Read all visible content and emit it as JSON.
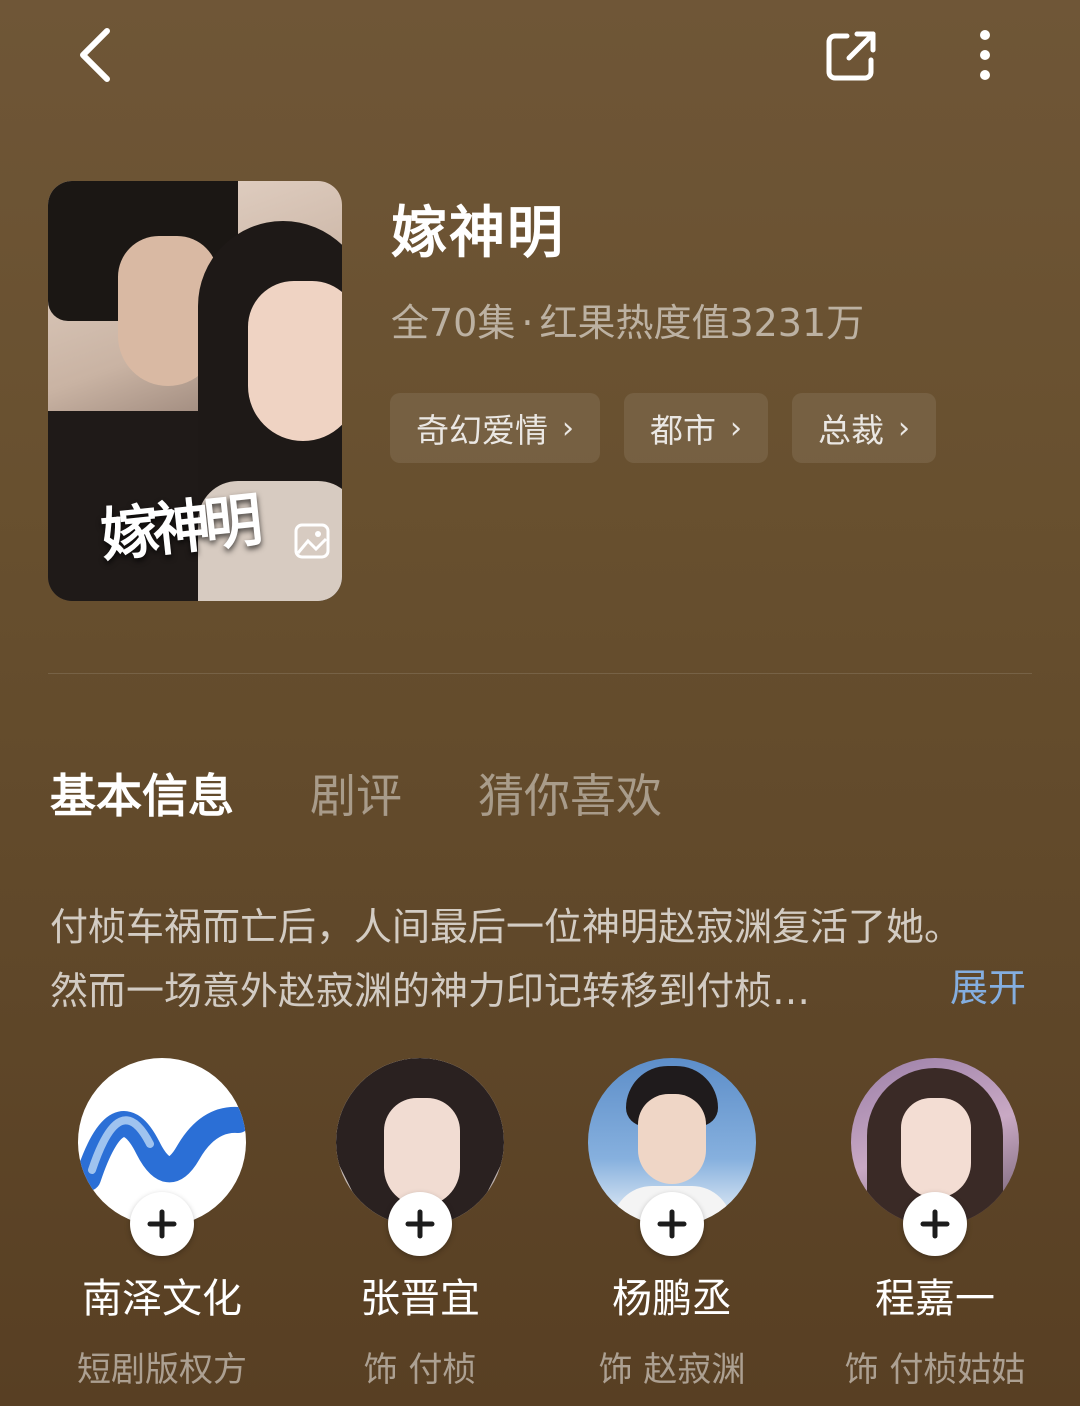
{
  "topbar": {
    "back_icon": "chevron-left-icon",
    "share_icon": "share-external-icon",
    "more_icon": "more-vertical-icon"
  },
  "drama": {
    "title": "嫁神明",
    "poster_title": "嫁神明",
    "meta_episodes": "全70集",
    "meta_separator": "·",
    "meta_heat": "红果热度值3231万",
    "tags": [
      "奇幻爱情",
      "都市",
      "总裁"
    ]
  },
  "tabs": [
    "基本信息",
    "剧评",
    "猜你喜欢"
  ],
  "description": {
    "line1": "付桢车祸而亡后，人间最后一位神明赵寂渊复活了她。",
    "line2": "然而一场意外赵寂渊的神力印记转移到付桢…",
    "expand_label": "展开"
  },
  "people": [
    {
      "name": "南泽文化",
      "role": "短剧版权方"
    },
    {
      "name": "张晋宜",
      "role": "饰 付桢"
    },
    {
      "name": "杨鹏丞",
      "role": "饰 赵寂渊"
    },
    {
      "name": "程嘉一",
      "role": "饰 付桢姑姑"
    }
  ],
  "colors": {
    "background": "#68502f",
    "expand_link": "#84aee0",
    "logo_blue": "#2b6fd6"
  }
}
